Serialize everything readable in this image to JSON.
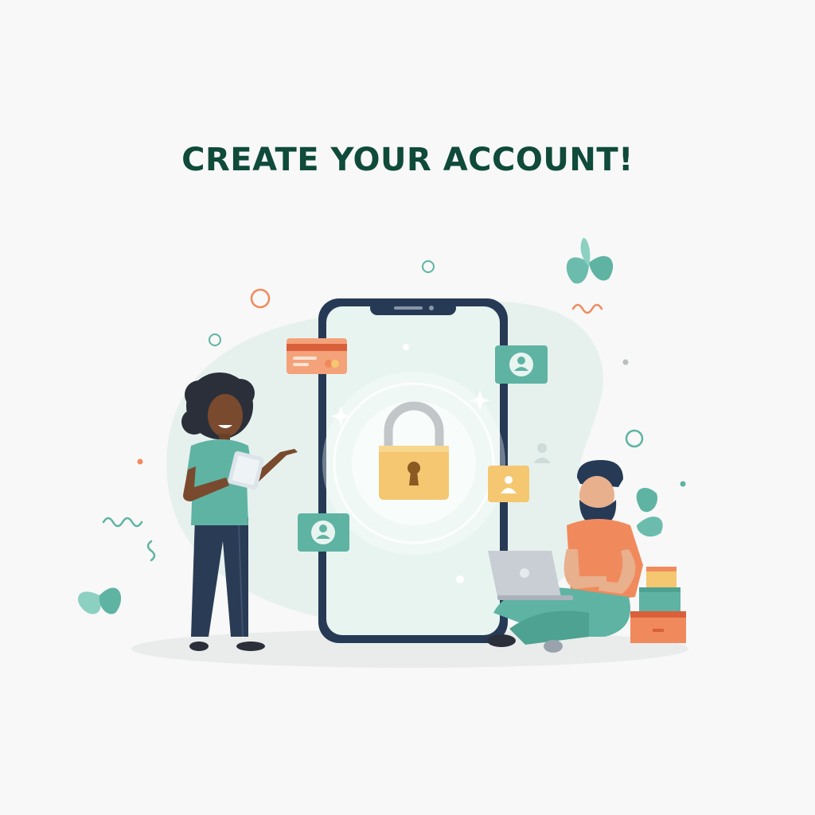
{
  "headline": "CREATE YOUR ACCOUNT!",
  "icons": {
    "lock": "padlock-icon",
    "card": "credit-card-icon",
    "profile": "user-profile-icon",
    "phone": "smartphone-icon",
    "laptop": "laptop-icon",
    "tablet": "tablet-icon",
    "leaf": "leaf-icon"
  },
  "colors": {
    "headline": "#0f4a3a",
    "teal": "#5fb3a3",
    "orange": "#f08a5d",
    "gold": "#f4c770",
    "navy": "#263a56",
    "screen": "#e8f4f0"
  }
}
